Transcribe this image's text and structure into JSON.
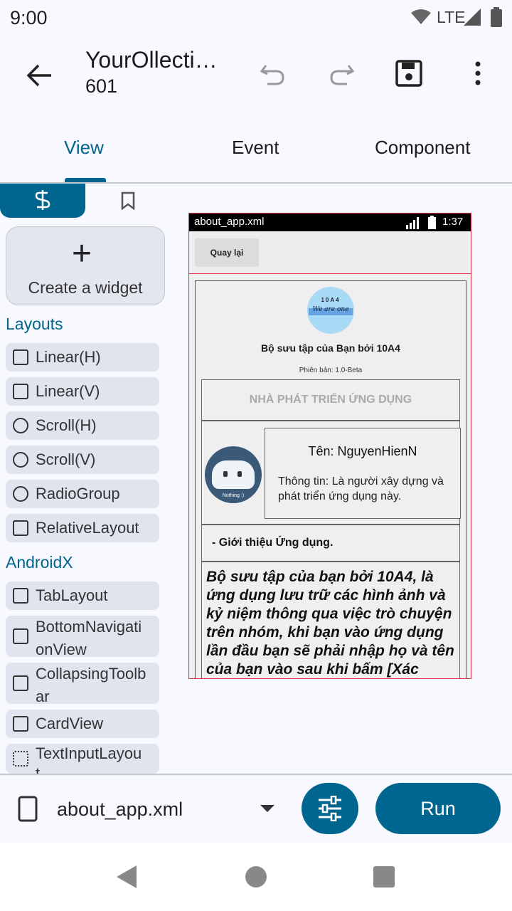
{
  "status": {
    "time": "9:00",
    "network": "LTE"
  },
  "appbar": {
    "title": "YourOllecti…",
    "subtitle": "601"
  },
  "tabs": [
    "View",
    "Event",
    "Component"
  ],
  "palette": {
    "create_label": "Create a widget",
    "sections": [
      "Layouts",
      "AndroidX"
    ],
    "layouts": [
      "Linear(H)",
      "Linear(V)",
      "Scroll(H)",
      "Scroll(V)",
      "RadioGroup",
      "RelativeLayout"
    ],
    "androidx": [
      "TabLayout",
      "BottomNavigati\nonView",
      "CollapsingToolb\nar",
      "CardView",
      "TextInputLayou\nt"
    ]
  },
  "preview": {
    "file": "about_app.xml",
    "clock": "1:37",
    "back_button": "Quay lại",
    "logo_top": "10A4",
    "logo_text": "We are one",
    "app_name": "Bộ sưu tập của Bạn bởi 10A4",
    "version": "Phiên bản: 1.0-Beta",
    "dev_header": "NHÀ PHÁT TRIỂN ỨNG DỤNG",
    "avatar_label": "Nothing :)",
    "name": "Tên: NguyenHienN",
    "info": "Thông tin: Là người xây dựng và phát triển ứng dụng này.",
    "intro_header": "- Giới thiệu Ứng dụng.",
    "intro_body": "Bộ sưu tập của bạn bởi 10A4, là ứng dụng lưu trữ các hình ảnh và kỷ niệm thông qua việc trò chuyện trên nhóm, khi bạn vào ứng dụng lần đầu bạn sẽ phải nhập họ và tên của bạn vào sau khi bấm [Xác nhận] thì"
  },
  "bottom": {
    "file": "about_app.xml",
    "run": "Run"
  },
  "colors": {
    "accent": "#00658f",
    "background": "#f8f9ff",
    "chip": "#dfe4ee"
  }
}
